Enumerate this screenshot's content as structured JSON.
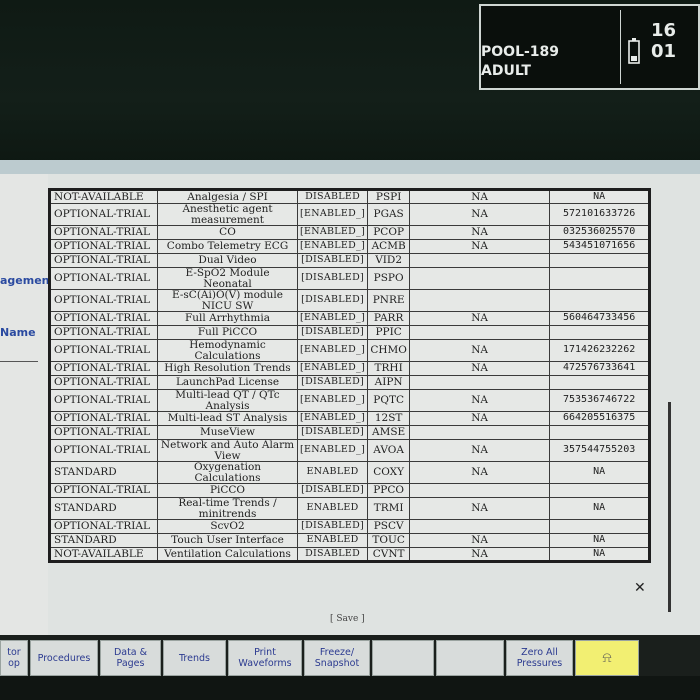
{
  "status": {
    "patient": "POOL-189",
    "category": "ADULT",
    "clock": "16 01"
  },
  "left_labels": {
    "label_1": "agement",
    "label_2": "Name"
  },
  "table": {
    "rows": [
      {
        "status": "NOT-AVAILABLE",
        "name": "Analgesia / SPI",
        "state": "DISABLED",
        "code": "PSPI",
        "field": "NA",
        "key": "NA"
      },
      {
        "status": "OPTIONAL-TRIAL",
        "name": "Anesthetic agent measurement",
        "state": "[ENABLED_]",
        "code": "PGAS",
        "field": "NA",
        "key": "572101633726"
      },
      {
        "status": "OPTIONAL-TRIAL",
        "name": "CO",
        "state": "[ENABLED_]",
        "code": "PCOP",
        "field": "NA",
        "key": "032536025570"
      },
      {
        "status": "OPTIONAL-TRIAL",
        "name": "Combo Telemetry ECG",
        "state": "[ENABLED_]",
        "code": "ACMB",
        "field": "NA",
        "key": "543451071656"
      },
      {
        "status": "OPTIONAL-TRIAL",
        "name": "Dual Video",
        "state": "[DISABLED]",
        "code": "VID2",
        "field": "",
        "key": ""
      },
      {
        "status": "OPTIONAL-TRIAL",
        "name": "E-SpO2 Module Neonatal",
        "state": "[DISABLED]",
        "code": "PSPO",
        "field": "",
        "key": ""
      },
      {
        "status": "OPTIONAL-TRIAL",
        "name": "E-sC(Ai)O(V) module NICU SW",
        "state": "[DISABLED]",
        "code": "PNRE",
        "field": "",
        "key": ""
      },
      {
        "status": "OPTIONAL-TRIAL",
        "name": "Full Arrhythmia",
        "state": "[ENABLED_]",
        "code": "PARR",
        "field": "NA",
        "key": "560464733456"
      },
      {
        "status": "OPTIONAL-TRIAL",
        "name": "Full PiCCO",
        "state": "[DISABLED]",
        "code": "PPIC",
        "field": "",
        "key": ""
      },
      {
        "status": "OPTIONAL-TRIAL",
        "name": "Hemodynamic Calculations",
        "state": "[ENABLED_]",
        "code": "CHMO",
        "field": "NA",
        "key": "171426232262"
      },
      {
        "status": "OPTIONAL-TRIAL",
        "name": "High Resolution Trends",
        "state": "[ENABLED_]",
        "code": "TRHI",
        "field": "NA",
        "key": "472576733641"
      },
      {
        "status": "OPTIONAL-TRIAL",
        "name": "LaunchPad License",
        "state": "[DISABLED]",
        "code": "AIPN",
        "field": "",
        "key": ""
      },
      {
        "status": "OPTIONAL-TRIAL",
        "name": "Multi-lead QT / QTc Analysis",
        "state": "[ENABLED_]",
        "code": "PQTC",
        "field": "NA",
        "key": "753536746722"
      },
      {
        "status": "OPTIONAL-TRIAL",
        "name": "Multi-lead ST Analysis",
        "state": "[ENABLED_]",
        "code": "12ST",
        "field": "NA",
        "key": "664205516375"
      },
      {
        "status": "OPTIONAL-TRIAL",
        "name": "MuseView",
        "state": "[DISABLED]",
        "code": "AMSE",
        "field": "",
        "key": ""
      },
      {
        "status": "OPTIONAL-TRIAL",
        "name": "Network and Auto Alarm View",
        "state": "[ENABLED_]",
        "code": "AVOA",
        "field": "NA",
        "key": "357544755203"
      },
      {
        "status": "STANDARD",
        "name": "Oxygenation Calculations",
        "state": "ENABLED",
        "code": "COXY",
        "field": "NA",
        "key": "NA"
      },
      {
        "status": "OPTIONAL-TRIAL",
        "name": "PiCCO",
        "state": "[DISABLED]",
        "code": "PPCO",
        "field": "",
        "key": ""
      },
      {
        "status": "STANDARD",
        "name": "Real-time Trends / minitrends",
        "state": "ENABLED",
        "code": "TRMI",
        "field": "NA",
        "key": "NA"
      },
      {
        "status": "OPTIONAL-TRIAL",
        "name": "ScvO2",
        "state": "[DISABLED]",
        "code": "PSCV",
        "field": "",
        "key": ""
      },
      {
        "status": "STANDARD",
        "name": "Touch User Interface",
        "state": "ENABLED",
        "code": "TOUC",
        "field": "NA",
        "key": "NA"
      },
      {
        "status": "NOT-AVAILABLE",
        "name": "Ventilation Calculations",
        "state": "DISABLED",
        "code": "CVNT",
        "field": "NA",
        "key": "NA"
      }
    ]
  },
  "save_label": "[ Save ]",
  "softkeys": [
    {
      "label": "tor op"
    },
    {
      "label": "Procedures"
    },
    {
      "label": "Data & Pages"
    },
    {
      "label": "Trends"
    },
    {
      "label": "Print Waveforms"
    },
    {
      "label": "Freeze/ Snapshot"
    },
    {
      "label": ""
    },
    {
      "label": ""
    },
    {
      "label": "Zero All Pressures"
    },
    {
      "label": ""
    }
  ],
  "colors": {
    "screen_bg": "#dfe3e1",
    "softkey_text": "#2b3a90",
    "alarm_key": "#f2ef72"
  }
}
